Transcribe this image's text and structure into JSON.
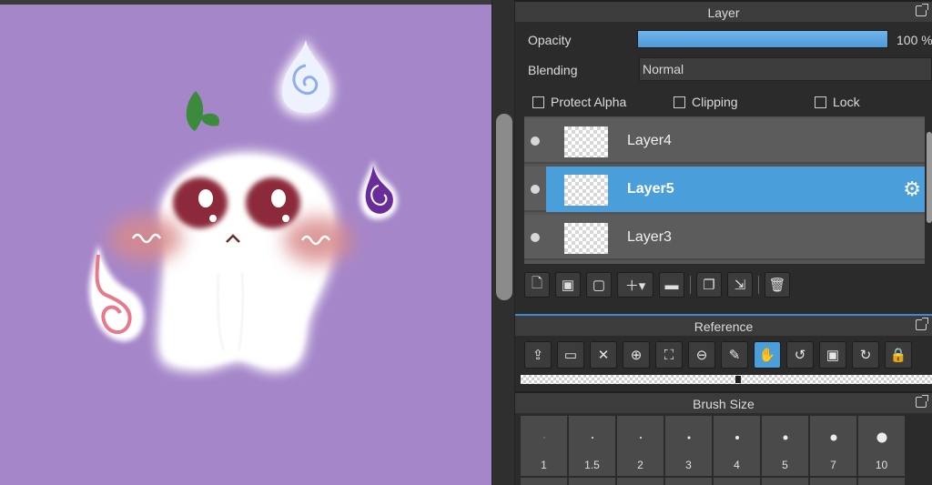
{
  "layer_panel": {
    "title": "Layer",
    "opacity_label": "Opacity",
    "opacity_value": "100 %",
    "opacity_fraction": 1.0,
    "blending_label": "Blending",
    "blending_value": "Normal",
    "checkboxes": {
      "protect_alpha": "Protect Alpha",
      "clipping": "Clipping",
      "lock": "Lock"
    },
    "layers": [
      {
        "name": "Layer4",
        "selected": false
      },
      {
        "name": "Layer5",
        "selected": true
      },
      {
        "name": "Layer3",
        "selected": false
      }
    ],
    "toolbar_icons": [
      "new-layer-icon",
      "new-8bit-layer-icon",
      "new-1bit-layer-icon",
      "add-layer-menu-icon",
      "folder-icon",
      "duplicate-layer-icon",
      "merge-down-icon",
      "delete-layer-icon"
    ]
  },
  "reference_panel": {
    "title": "Reference",
    "toolbar_icons": [
      "upload-icon",
      "open-folder-icon",
      "close-icon",
      "zoom-in-icon",
      "fit-view-icon",
      "zoom-out-icon",
      "eyedropper-icon",
      "hand-icon",
      "rotate-left-icon",
      "fullscreen-icon",
      "rotate-right-icon",
      "lock-icon"
    ],
    "active_tool": "hand-icon"
  },
  "brush_panel": {
    "title": "Brush Size",
    "sizes": [
      "1",
      "1.5",
      "2",
      "3",
      "4",
      "5",
      "7",
      "10"
    ]
  },
  "colors": {
    "canvas_background": "#a586c9",
    "selection_accent": "#4a9fdb",
    "panel_background": "#2b2b2b"
  }
}
